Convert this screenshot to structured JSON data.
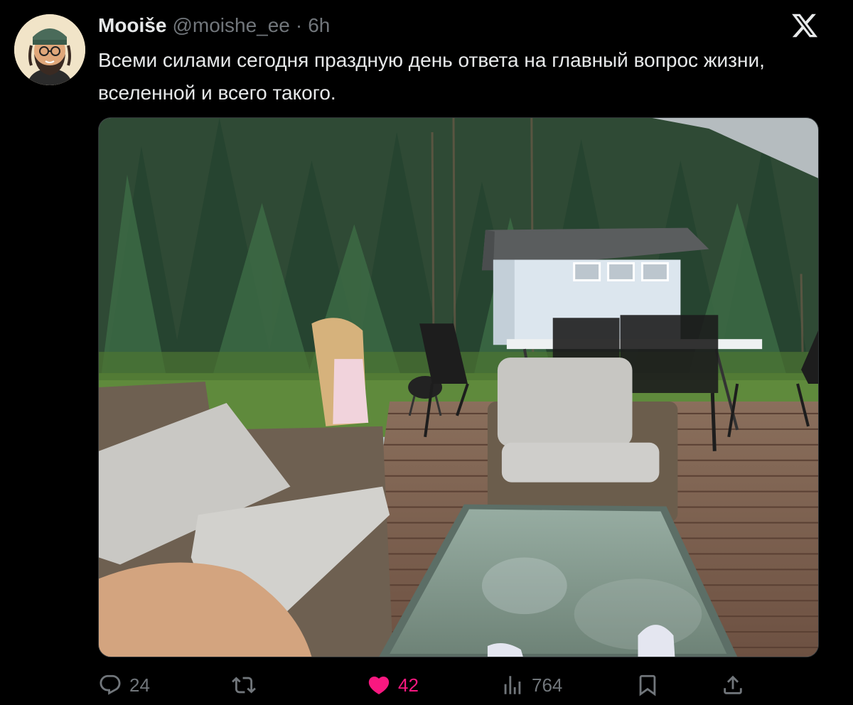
{
  "tweet": {
    "display_name": "Mooiše",
    "handle": "@moishe_ee",
    "separator": "·",
    "time": "6h",
    "text": "Всеми силами сегодня праздную день ответа на главный вопрос жизни, вселенной и всего такого."
  },
  "icons": {
    "platform_logo": "x-logo-icon",
    "reply": "reply-icon",
    "retweet": "retweet-icon",
    "like": "heart-icon",
    "views": "views-icon",
    "bookmark": "bookmark-icon",
    "share": "share-icon"
  },
  "actions": {
    "reply_count": "24",
    "retweet_count": "",
    "like_count": "42",
    "view_count": "764"
  },
  "colors": {
    "background": "#000000",
    "primary_text": "#e7e9ea",
    "secondary_text": "#71767b",
    "like_accent": "#f91880"
  }
}
